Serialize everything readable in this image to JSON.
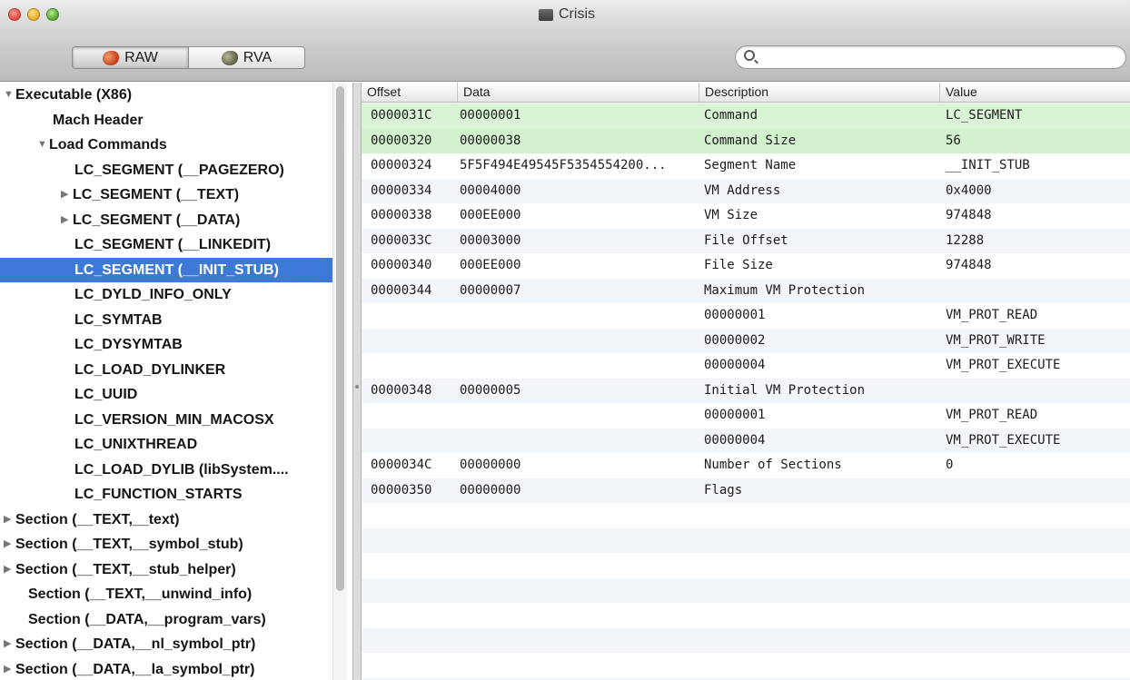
{
  "window": {
    "title": "Crisis"
  },
  "toolbar": {
    "raw_label": "RAW",
    "rva_label": "RVA",
    "search_placeholder": ""
  },
  "sidebar": {
    "items": [
      {
        "label": "Executable  (X86)",
        "indent": 0,
        "disclosure": "expanded",
        "selected": false
      },
      {
        "label": "Mach Header",
        "indent": 1,
        "disclosure": "none",
        "selected": false
      },
      {
        "label": "Load Commands",
        "indent": 1,
        "disclosure": "expanded",
        "selected": false
      },
      {
        "label": "LC_SEGMENT (__PAGEZERO)",
        "indent": 2,
        "disclosure": "none",
        "selected": false
      },
      {
        "label": "LC_SEGMENT (__TEXT)",
        "indent": 2,
        "disclosure": "collapsed",
        "selected": false
      },
      {
        "label": "LC_SEGMENT (__DATA)",
        "indent": 2,
        "disclosure": "collapsed",
        "selected": false
      },
      {
        "label": "LC_SEGMENT (__LINKEDIT)",
        "indent": 2,
        "disclosure": "none",
        "selected": false
      },
      {
        "label": "LC_SEGMENT (__INIT_STUB)",
        "indent": 2,
        "disclosure": "none",
        "selected": true
      },
      {
        "label": "LC_DYLD_INFO_ONLY",
        "indent": 2,
        "disclosure": "none",
        "selected": false
      },
      {
        "label": "LC_SYMTAB",
        "indent": 2,
        "disclosure": "none",
        "selected": false
      },
      {
        "label": "LC_DYSYMTAB",
        "indent": 2,
        "disclosure": "none",
        "selected": false
      },
      {
        "label": "LC_LOAD_DYLINKER",
        "indent": 2,
        "disclosure": "none",
        "selected": false
      },
      {
        "label": "LC_UUID",
        "indent": 2,
        "disclosure": "none",
        "selected": false
      },
      {
        "label": "LC_VERSION_MIN_MACOSX",
        "indent": 2,
        "disclosure": "none",
        "selected": false
      },
      {
        "label": "LC_UNIXTHREAD",
        "indent": 2,
        "disclosure": "none",
        "selected": false
      },
      {
        "label": "LC_LOAD_DYLIB (libSystem....",
        "indent": 2,
        "disclosure": "none",
        "selected": false
      },
      {
        "label": "LC_FUNCTION_STARTS",
        "indent": 2,
        "disclosure": "none",
        "selected": false
      },
      {
        "label": "Section (__TEXT,__text)",
        "indent": 0,
        "disclosure": "collapsed",
        "selected": false
      },
      {
        "label": "Section (__TEXT,__symbol_stub)",
        "indent": 0,
        "disclosure": "collapsed",
        "selected": false
      },
      {
        "label": "Section (__TEXT,__stub_helper)",
        "indent": 0,
        "disclosure": "collapsed",
        "selected": false
      },
      {
        "label": "Section (__TEXT,__unwind_info)",
        "indent": 1,
        "disclosure": "none",
        "selected": false
      },
      {
        "label": "Section (__DATA,__program_vars)",
        "indent": 1,
        "disclosure": "none",
        "selected": false
      },
      {
        "label": "Section (__DATA,__nl_symbol_ptr)",
        "indent": 0,
        "disclosure": "collapsed",
        "selected": false
      },
      {
        "label": "Section (__DATA,__la_symbol_ptr)",
        "indent": 0,
        "disclosure": "collapsed",
        "selected": false
      }
    ]
  },
  "table": {
    "columns": [
      "Offset",
      "Data",
      "Description",
      "Value"
    ],
    "rows": [
      {
        "offset": "0000031C",
        "data": "00000001",
        "description": "Command",
        "value": "LC_SEGMENT",
        "highlight": true
      },
      {
        "offset": "00000320",
        "data": "00000038",
        "description": "Command Size",
        "value": "56",
        "highlight": true
      },
      {
        "offset": "00000324",
        "data": "5F5F494E49545F5354554200...",
        "description": "Segment Name",
        "value": "__INIT_STUB",
        "highlight": false
      },
      {
        "offset": "00000334",
        "data": "00004000",
        "description": "VM Address",
        "value": "0x4000",
        "highlight": false
      },
      {
        "offset": "00000338",
        "data": "000EE000",
        "description": "VM Size",
        "value": "974848",
        "highlight": false
      },
      {
        "offset": "0000033C",
        "data": "00003000",
        "description": "File Offset",
        "value": "12288",
        "highlight": false
      },
      {
        "offset": "00000340",
        "data": "000EE000",
        "description": "File Size",
        "value": "974848",
        "highlight": false
      },
      {
        "offset": "00000344",
        "data": "00000007",
        "description": "Maximum VM Protection",
        "value": "",
        "highlight": false
      },
      {
        "offset": "",
        "data": "",
        "description": "00000001",
        "value": "VM_PROT_READ",
        "highlight": false
      },
      {
        "offset": "",
        "data": "",
        "description": "00000002",
        "value": "VM_PROT_WRITE",
        "highlight": false
      },
      {
        "offset": "",
        "data": "",
        "description": "00000004",
        "value": "VM_PROT_EXECUTE",
        "highlight": false
      },
      {
        "offset": "00000348",
        "data": "00000005",
        "description": "Initial VM Protection",
        "value": "",
        "highlight": false
      },
      {
        "offset": "",
        "data": "",
        "description": "00000001",
        "value": "VM_PROT_READ",
        "highlight": false
      },
      {
        "offset": "",
        "data": "",
        "description": "00000004",
        "value": "VM_PROT_EXECUTE",
        "highlight": false
      },
      {
        "offset": "0000034C",
        "data": "00000000",
        "description": "Number of Sections",
        "value": "0",
        "highlight": false
      },
      {
        "offset": "00000350",
        "data": "00000000",
        "description": "Flags",
        "value": "",
        "highlight": false
      }
    ]
  },
  "colors": {
    "selection": "#3d79d6",
    "highlight_row": "#d9f5d6",
    "alt_row": "#f2f5fa"
  }
}
